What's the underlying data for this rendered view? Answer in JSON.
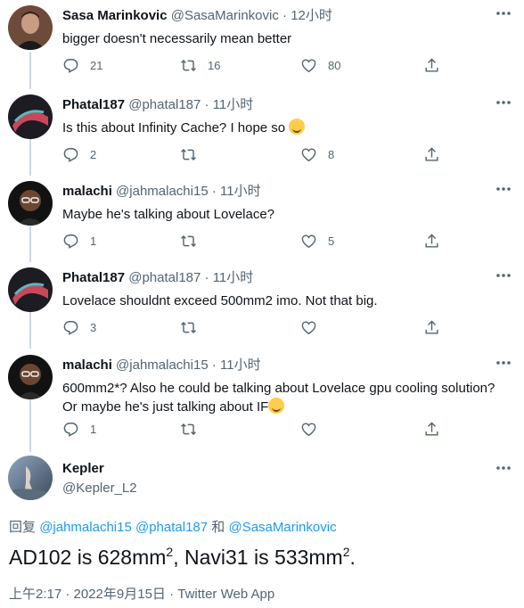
{
  "tweets": [
    {
      "name": "Sasa Marinkovic",
      "handle": "@SasaMarinkovic",
      "sep": "·",
      "time": "12小时",
      "text": "bigger doesn't necessarily mean better",
      "replies": "21",
      "retweets": "16",
      "likes": "80"
    },
    {
      "name": "Phatal187",
      "handle": "@phatal187",
      "sep": "·",
      "time": "11小时",
      "text": "Is this about Infinity Cache? I hope so",
      "replies": "2",
      "retweets": "",
      "likes": "8"
    },
    {
      "name": "malachi",
      "handle": "@jahmalachi15",
      "sep": "·",
      "time": "11小时",
      "text": "Maybe he's talking about Lovelace?",
      "replies": "1",
      "retweets": "",
      "likes": "5"
    },
    {
      "name": "Phatal187",
      "handle": "@phatal187",
      "sep": "·",
      "time": "11小时",
      "text": "Lovelace shouldnt exceed 500mm2 imo. Not that big.",
      "replies": "3",
      "retweets": "",
      "likes": ""
    },
    {
      "name": "malachi",
      "handle": "@jahmalachi15",
      "sep": "·",
      "time": "11小时",
      "text_line1": "600mm2*? Also he could be talking about Lovelace gpu cooling solution?",
      "text_line2": "Or maybe he's just talking about IF",
      "replies": "1",
      "retweets": "",
      "likes": ""
    }
  ],
  "main": {
    "name": "Kepler",
    "handle": "@Kepler_L2",
    "reply_prefix": "回复",
    "mention1": "@jahmalachi15",
    "mention2": "@phatal187",
    "reply_and": "和",
    "mention3": "@SasaMarinkovic",
    "text_part1": "AD102 is 628mm",
    "sup1": "2",
    "text_part2": ", Navi31 is 533mm",
    "sup2": "2",
    "text_part3": ".",
    "timestamp": "上午2:17 · 2022年9月15日 · Twitter Web App"
  },
  "colors": {
    "text": "#0f1419",
    "muted": "#536471",
    "link": "#1d9bf0",
    "thread_line": "#cfd9de"
  },
  "icons": [
    "reply-icon",
    "retweet-icon",
    "like-icon",
    "share-icon",
    "more-icon",
    "emoji-sweat-smile"
  ]
}
